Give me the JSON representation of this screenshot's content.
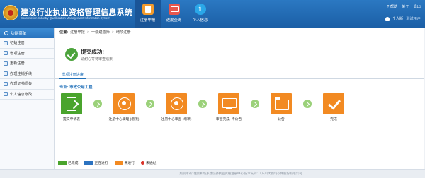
{
  "header": {
    "system_title": "建设行业执业资格管理信息系统",
    "system_subtitle": "Construction Industry Qualification Management Information System",
    "nav": [
      {
        "label": "注册申报",
        "icon": "application-form-icon",
        "active": true
      },
      {
        "label": "进度查询",
        "icon": "progress-query-icon",
        "active": false
      },
      {
        "label": "个人信息",
        "icon": "info-icon",
        "active": false
      }
    ],
    "links": {
      "help": "? 帮助",
      "about": "关于",
      "logout": "退出"
    },
    "user": {
      "label": "个人版",
      "name": "测试用户"
    }
  },
  "sidebar": {
    "title": "功能菜单",
    "items": [
      {
        "label": "初始注册"
      },
      {
        "label": "增项注册"
      },
      {
        "label": "重新注册"
      },
      {
        "label": "办理注销手续"
      },
      {
        "label": "办理证书遗失"
      },
      {
        "label": "个人信息修改"
      }
    ]
  },
  "breadcrumb": {
    "label": "位置:",
    "path": [
      "注册申报",
      "一级建造师",
      "增项注册"
    ],
    "separator": ">"
  },
  "success": {
    "title": "提交成功!",
    "message": "请耐心等待审查结果!"
  },
  "tab": {
    "label": "增项注册进度"
  },
  "specialty": "专业: 市政公用工程",
  "flow": {
    "steps": [
      {
        "label": "提交申请表",
        "status": "done",
        "icon": "document-check-icon"
      },
      {
        "label": "注册中心受理 (增项)",
        "status": "pending",
        "icon": "seal-icon"
      },
      {
        "label": "注册中心审查 (增项)",
        "status": "pending",
        "icon": "seal-icon"
      },
      {
        "label": "审查完成, 待公告",
        "status": "pending",
        "icon": "monitor-icon"
      },
      {
        "label": "公告",
        "status": "pending",
        "icon": "folder-icon"
      },
      {
        "label": "完成",
        "status": "pending",
        "icon": "checkmark-icon"
      }
    ]
  },
  "legend": [
    {
      "label": "已完成",
      "color": "#4aa42d"
    },
    {
      "label": "正在进行",
      "color": "#2b72c0"
    },
    {
      "label": "未进行",
      "color": "#f28a22"
    },
    {
      "label": "未通过",
      "color": "#d9332a"
    }
  ],
  "footer": "版权所有: 住房和城乡建设部执业资格注册中心    技术支持: 山东山大鸥玛软件股份有限公司"
}
